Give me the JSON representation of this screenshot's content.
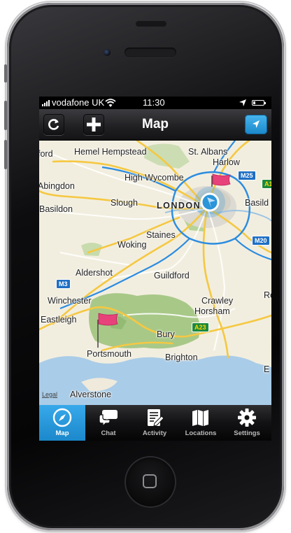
{
  "status_bar": {
    "carrier": "vodafone UK",
    "time": "11:30"
  },
  "nav_bar": {
    "title": "Map"
  },
  "map": {
    "labels": {
      "hemel": "Hemel Hempstead",
      "st_albans": "St. Albans",
      "harlow": "Harlow",
      "ford": "ford",
      "abingdon": "Abingdon",
      "high_wycombe": "High Wycombe",
      "basildon_w": "Basildon",
      "slough": "Slough",
      "london": "LONDON",
      "basildon_e": "Basild",
      "staines": "Staines",
      "woking": "Woking",
      "aldershot": "Aldershot",
      "guildford": "Guildford",
      "winchester": "Winchester",
      "crawley": "Crawley",
      "horsham": "Horsham",
      "eastleigh": "Eastleigh",
      "bury": "Bury",
      "portsmouth": "Portsmouth",
      "brighton": "Brighton",
      "alverstone": "Alverstone",
      "re": "Re",
      "e": "E"
    },
    "shields": {
      "m25": "M25",
      "a1": "A1",
      "m20": "M20",
      "m3": "M3",
      "a23": "A23"
    },
    "legal": "Legal",
    "colors": {
      "land": "#f2eedf",
      "park": "#a8c888",
      "sea": "#a9cce8",
      "urban": "#dcdad2",
      "motorway": "#f5c842",
      "flag": "#e8427a",
      "accent": "#2a95d8"
    }
  },
  "tabs": [
    {
      "label": "Map",
      "icon": "compass-icon",
      "active": true
    },
    {
      "label": "Chat",
      "icon": "chat-bubbles-icon",
      "active": false
    },
    {
      "label": "Activity",
      "icon": "activity-icon",
      "active": false
    },
    {
      "label": "Locations",
      "icon": "map-book-icon",
      "active": false
    },
    {
      "label": "Settings",
      "icon": "gear-icon",
      "active": false
    }
  ]
}
